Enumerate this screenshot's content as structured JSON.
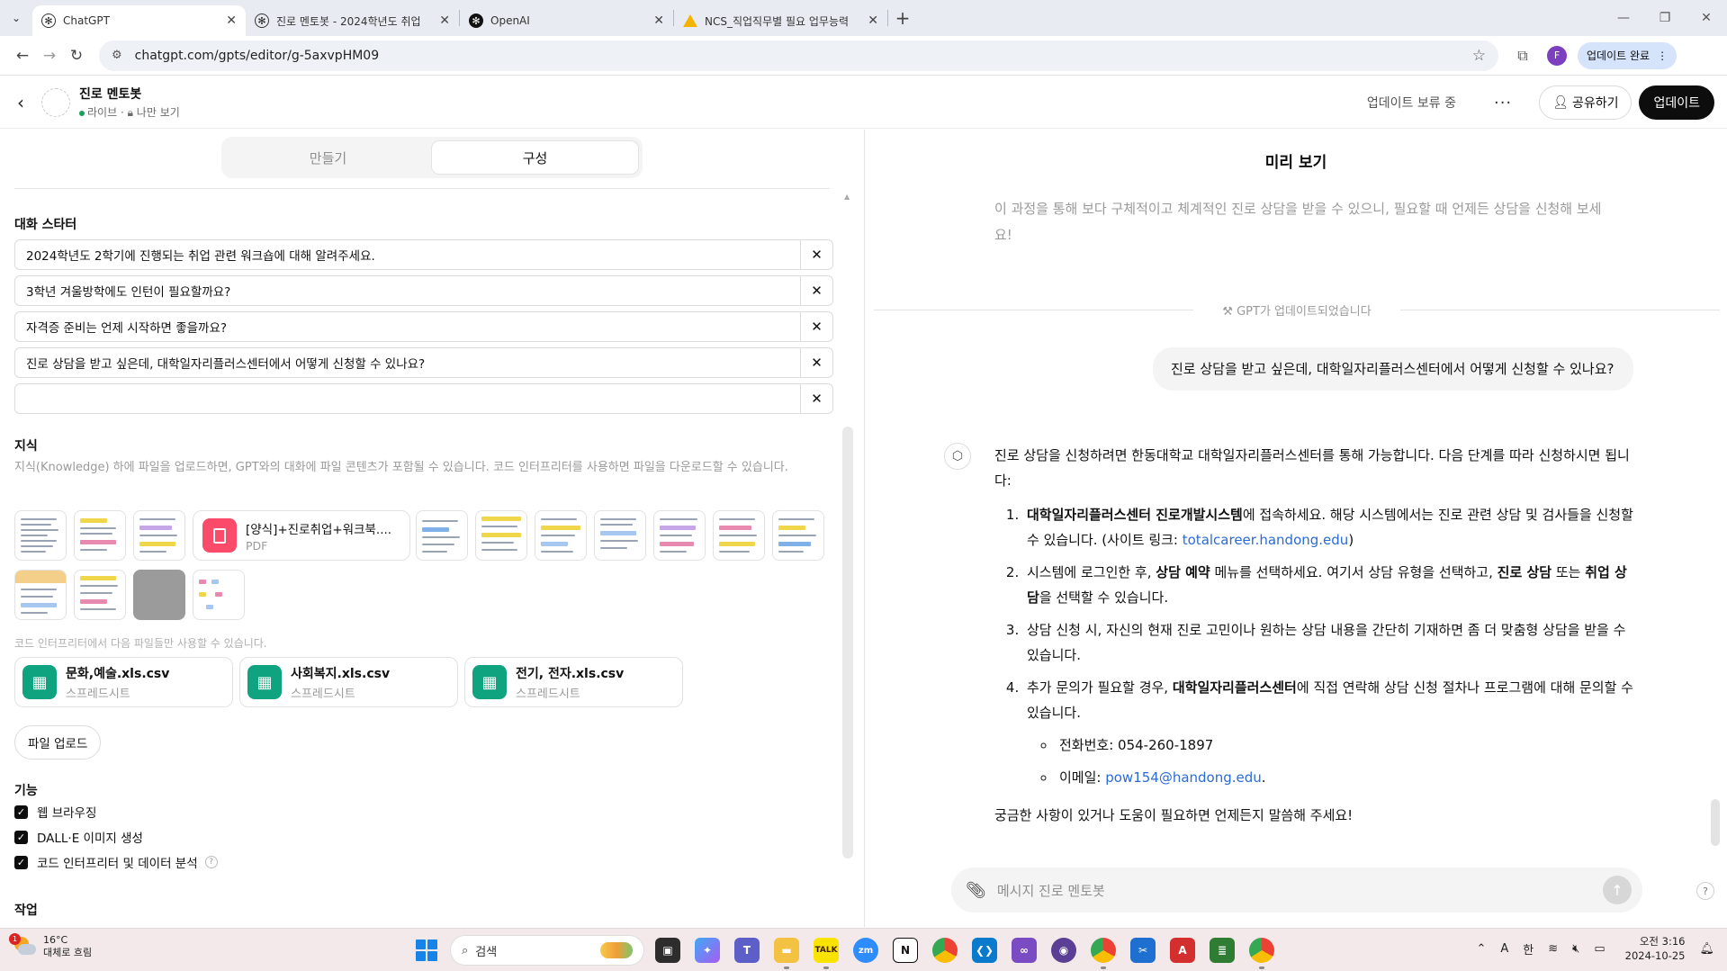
{
  "browser": {
    "tabs": [
      {
        "title": "ChatGPT",
        "active": true
      },
      {
        "title": "진로 멘토봇 - 2024학년도 취업",
        "active": false
      },
      {
        "title": "OpenAI",
        "active": false
      },
      {
        "title": "NCS_직업직무별 필요 업무능력",
        "active": false
      }
    ],
    "url": "chatgpt.com/gpts/editor/g-5axvpHM09",
    "profile_initial": "F",
    "update_pill": "업데이트 완료"
  },
  "header": {
    "gpt_name": "진로 멘토봇",
    "status_live": "라이브",
    "visibility": "나만 보기",
    "pending_text": "업데이트 보류 중",
    "share_label": "공유하기",
    "update_label": "업데이트"
  },
  "editor": {
    "tabs": {
      "create": "만들기",
      "configure": "구성"
    },
    "starters_title": "대화 스타터",
    "starters": [
      "2024학년도 2학기에 진행되는 취업 관련 워크숍에 대해 알려주세요.",
      "3학년 겨울방학에도 인턴이 필요할까요?",
      "자격증 준비는 언제 시작하면 좋을까요?",
      "진로 상담을 받고 싶은데, 대학일자리플러스센터에서 어떻게 신청할 수 있나요?",
      ""
    ],
    "knowledge_title": "지식",
    "knowledge_desc": "지식(Knowledge) 하에 파일을 업로드하면, GPT와의 대화에 파일 콘텐츠가 포함될 수 있습니다. 코드 인터프리터를 사용하면 파일을 다운로드할 수 있습니다.",
    "pdf_file": {
      "name": "[양식]+진로취업+워크북....",
      "type": "PDF"
    },
    "code_files_note": "코드 인터프리터에서 다음 파일들만 사용할 수 있습니다.",
    "files": [
      {
        "name": "문화,예술.xls.csv",
        "type": "스프레드시트"
      },
      {
        "name": "사회복지.xls.csv",
        "type": "스프레드시트"
      },
      {
        "name": "전기, 전자.xls.csv",
        "type": "스프레드시트"
      }
    ],
    "upload_label": "파일 업로드",
    "capabilities_title": "기능",
    "capabilities": [
      {
        "label": "웹 브라우징",
        "checked": true
      },
      {
        "label": "DALL·E 이미지 생성",
        "checked": true
      },
      {
        "label": "코드 인터프리터 및 데이터 분석",
        "checked": true
      }
    ],
    "actions_title": "작업"
  },
  "preview": {
    "title": "미리 보기",
    "faded_text": "이 과정을 통해 보다 구체적이고 체계적인 진로 상담을 받을 수 있으니, 필요할 때 언제든 상담을 신청해 보세요!",
    "updated_notice": "GPT가 업데이트되었습니다",
    "user_message": "진로 상담을 받고 싶은데, 대학일자리플러스센터에서 어떻게 신청할 수 있나요?",
    "bot_intro": "진로 상담을 신청하려면 한동대학교 대학일자리플러스센터를 통해 가능합니다. 다음 단계를 따라 신청하시면 됩니다:",
    "steps": {
      "s1_b": "대학일자리플러스센터 진로개발시스템",
      "s1_t": "에 접속하세요. 해당 시스템에서는 진로 관련 상담 및 검사들을 신청할 수 있습니다. (사이트 링크: ",
      "s1_link": "totalcareer.handong.edu",
      "s1_end": ")",
      "s2_a": "시스템에 로그인한 후, ",
      "s2_b1": "상담 예약",
      "s2_c": " 메뉴를 선택하세요. 여기서 상담 유형을 선택하고, ",
      "s2_b2": "진로 상담",
      "s2_d": " 또는 ",
      "s2_b3": "취업 상담",
      "s2_e": "을 선택할 수 있습니다.",
      "s3": "상담 신청 시, 자신의 현재 진로 고민이나 원하는 상담 내용을 간단히 기재하면 좀 더 맞춤형 상담을 받을 수 있습니다.",
      "s4_a": "추가 문의가 필요할 경우, ",
      "s4_b": "대학일자리플러스센터",
      "s4_c": "에 직접 연락해 상담 신청 절차나 프로그램에 대해 문의할 수 있습니다."
    },
    "phone": "전화번호: 054-260-1897",
    "email_label": "이메일: ",
    "email": "pow154@handong.edu",
    "email_end": ".",
    "closing": "궁금한 사항이 있거나 도움이 필요하면 언제든지 말씀해 주세요!",
    "composer_placeholder": "메시지 진로 멘토봇"
  },
  "taskbar": {
    "temp": "16°C",
    "weather": "대체로 흐림",
    "weather_badge": "1",
    "search": "검색",
    "tray_a": "A",
    "tray_han": "한",
    "time": "오전 3:16",
    "date": "2024-10-25"
  }
}
